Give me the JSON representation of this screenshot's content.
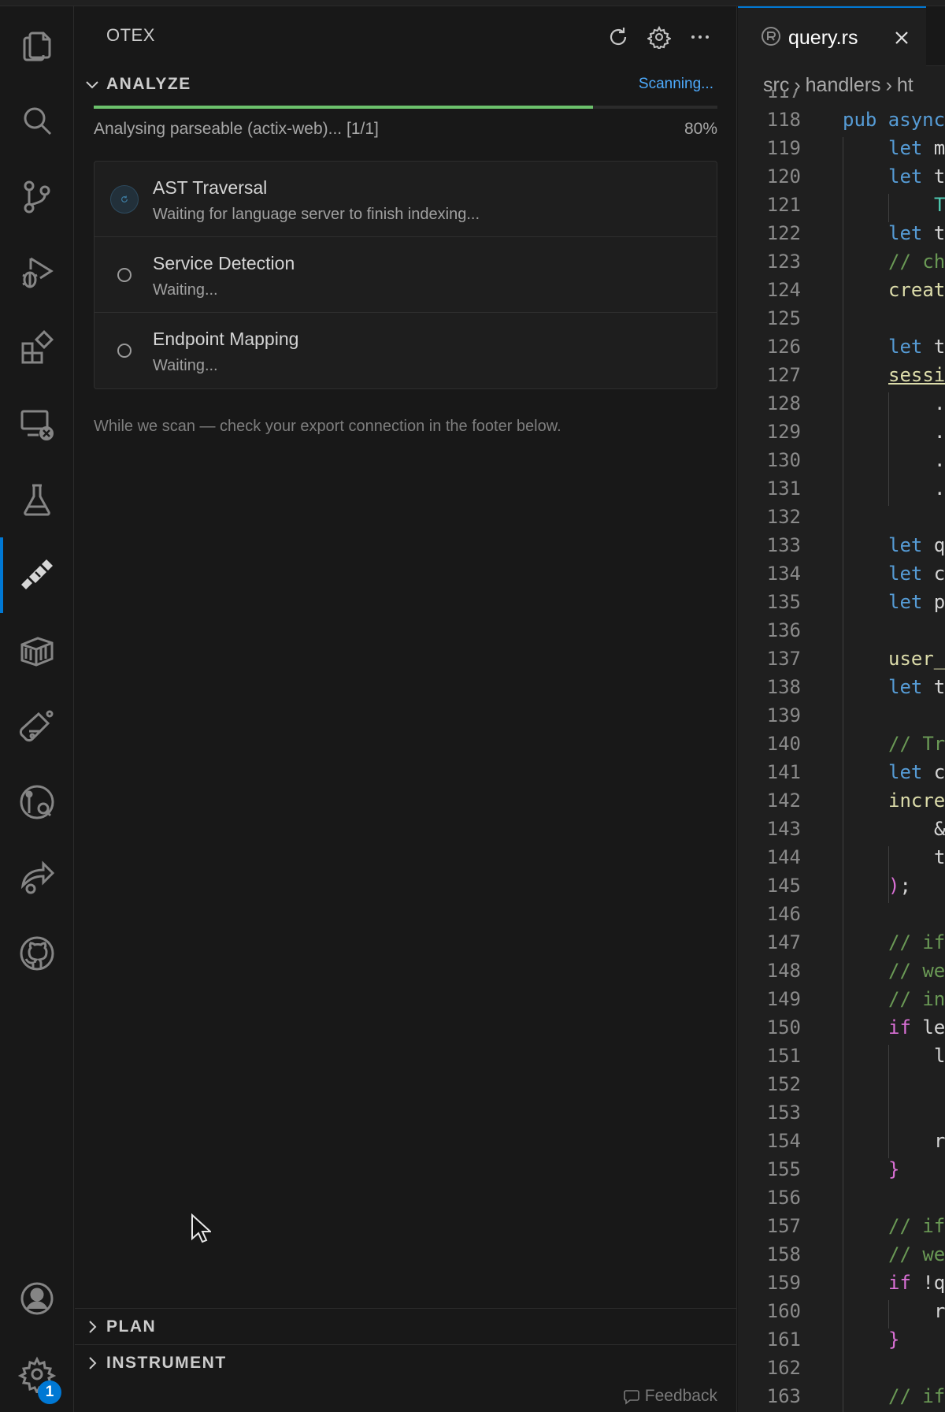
{
  "activity_bar": {
    "items": [
      {
        "name": "explorer-icon"
      },
      {
        "name": "search-icon"
      },
      {
        "name": "source-control-icon"
      },
      {
        "name": "run-debug-icon"
      },
      {
        "name": "extensions-icon"
      },
      {
        "name": "remote-explorer-icon"
      },
      {
        "name": "testing-icon"
      },
      {
        "name": "otex-icon",
        "active": true
      },
      {
        "name": "containers-icon"
      },
      {
        "name": "lab-flask-icon"
      },
      {
        "name": "timeline-search-icon"
      },
      {
        "name": "share-icon"
      },
      {
        "name": "github-icon"
      }
    ],
    "accounts_icon": "account-icon",
    "manage_icon": "settings-gear-icon",
    "manage_badge": "1",
    "accent": "#0078d4"
  },
  "panel": {
    "title": "OTEX",
    "actions": [
      "refresh-icon",
      "gear-icon",
      "more-icon"
    ],
    "analyze": {
      "label": "ANALYZE",
      "status": "Scanning...",
      "progress_text": "Analysing parseable (actix-web)... [1/1]",
      "progress_pct": "80%",
      "progress_value": 0.8,
      "steps": [
        {
          "title": "AST Traversal",
          "subtitle": "Waiting for language server to finish indexing...",
          "state": "running"
        },
        {
          "title": "Service Detection",
          "subtitle": "Waiting...",
          "state": "waiting"
        },
        {
          "title": "Endpoint Mapping",
          "subtitle": "Waiting...",
          "state": "waiting"
        }
      ],
      "hint": "While we scan — check your export connection in the footer below."
    },
    "plan_label": "PLAN",
    "instrument_label": "INSTRUMENT",
    "feedback_label": "Feedback"
  },
  "editor": {
    "tab_label": "query.rs",
    "breadcrumb": [
      "src",
      "handlers",
      "ht"
    ],
    "lines": [
      {
        "n": "117",
        "text": ""
      },
      {
        "n": "118",
        "segs": [
          [
            "kw",
            "pub async"
          ]
        ]
      },
      {
        "n": "119",
        "segs": [
          [
            "kw",
            "let"
          ],
          [
            "pl",
            " m"
          ]
        ]
      },
      {
        "n": "120",
        "segs": [
          [
            "kw",
            "let"
          ],
          [
            "pl",
            " t"
          ]
        ]
      },
      {
        "n": "121",
        "segs": [
          [
            "ty",
            "T"
          ]
        ],
        "indent": 2
      },
      {
        "n": "122",
        "segs": [
          [
            "kw",
            "let"
          ],
          [
            "pl",
            " t"
          ]
        ]
      },
      {
        "n": "123",
        "segs": [
          [
            "cm",
            "// ch"
          ]
        ]
      },
      {
        "n": "124",
        "segs": [
          [
            "fn",
            "creat"
          ]
        ]
      },
      {
        "n": "125",
        "segs": []
      },
      {
        "n": "126",
        "segs": [
          [
            "kw",
            "let"
          ],
          [
            "pl",
            " t"
          ]
        ]
      },
      {
        "n": "127",
        "segs": [
          [
            "fn",
            "sessi"
          ]
        ],
        "underline": true
      },
      {
        "n": "128",
        "segs": [
          [
            "pl",
            "."
          ]
        ],
        "indent": 2
      },
      {
        "n": "129",
        "segs": [
          [
            "pl",
            "."
          ]
        ],
        "indent": 2
      },
      {
        "n": "130",
        "segs": [
          [
            "pl",
            "."
          ]
        ],
        "indent": 2
      },
      {
        "n": "131",
        "segs": [
          [
            "pl",
            "."
          ]
        ],
        "indent": 2
      },
      {
        "n": "132",
        "segs": []
      },
      {
        "n": "133",
        "segs": [
          [
            "kw",
            "let"
          ],
          [
            "pl",
            " q"
          ]
        ]
      },
      {
        "n": "134",
        "segs": [
          [
            "kw",
            "let"
          ],
          [
            "pl",
            " c"
          ]
        ]
      },
      {
        "n": "135",
        "segs": [
          [
            "kw",
            "let"
          ],
          [
            "pl",
            " p"
          ]
        ]
      },
      {
        "n": "136",
        "segs": []
      },
      {
        "n": "137",
        "segs": [
          [
            "fn",
            "user_"
          ]
        ]
      },
      {
        "n": "138",
        "segs": [
          [
            "kw",
            "let"
          ],
          [
            "pl",
            " t"
          ]
        ]
      },
      {
        "n": "139",
        "segs": []
      },
      {
        "n": "140",
        "segs": [
          [
            "cm",
            "// Tr"
          ]
        ]
      },
      {
        "n": "141",
        "segs": [
          [
            "kw",
            "let"
          ],
          [
            "pl",
            " c"
          ]
        ]
      },
      {
        "n": "142",
        "segs": [
          [
            "fn",
            "incre"
          ]
        ]
      },
      {
        "n": "143",
        "segs": [
          [
            "pl",
            "&"
          ]
        ],
        "indent": 2
      },
      {
        "n": "144",
        "segs": [
          [
            "pl",
            "t"
          ]
        ],
        "indent": 2
      },
      {
        "n": "145",
        "segs": [
          [
            "pn",
            ")"
          ],
          [
            "pl",
            ";"
          ]
        ]
      },
      {
        "n": "146",
        "segs": []
      },
      {
        "n": "147",
        "segs": [
          [
            "cm",
            "// if"
          ]
        ]
      },
      {
        "n": "148",
        "segs": [
          [
            "cm",
            "// we"
          ]
        ]
      },
      {
        "n": "149",
        "segs": [
          [
            "cm",
            "// in"
          ]
        ]
      },
      {
        "n": "150",
        "segs": [
          [
            "pn",
            "if"
          ],
          [
            "pl",
            " le"
          ]
        ]
      },
      {
        "n": "151",
        "segs": [
          [
            "pl",
            "l"
          ]
        ],
        "indent": 2
      },
      {
        "n": "152",
        "segs": []
      },
      {
        "n": "153",
        "segs": []
      },
      {
        "n": "154",
        "segs": [
          [
            "pl",
            "r"
          ]
        ],
        "indent": 2
      },
      {
        "n": "155",
        "segs": [
          [
            "pn",
            "}"
          ]
        ]
      },
      {
        "n": "156",
        "segs": []
      },
      {
        "n": "157",
        "segs": [
          [
            "cm",
            "// if"
          ]
        ]
      },
      {
        "n": "158",
        "segs": [
          [
            "cm",
            "// we"
          ]
        ]
      },
      {
        "n": "159",
        "segs": [
          [
            "pn",
            "if"
          ],
          [
            "pl",
            " !q"
          ]
        ]
      },
      {
        "n": "160",
        "segs": [
          [
            "pl",
            "r"
          ]
        ],
        "indent": 2
      },
      {
        "n": "161",
        "segs": [
          [
            "pn",
            "}"
          ]
        ]
      },
      {
        "n": "162",
        "segs": []
      },
      {
        "n": "163",
        "segs": [
          [
            "cm",
            "// if"
          ]
        ]
      }
    ]
  }
}
